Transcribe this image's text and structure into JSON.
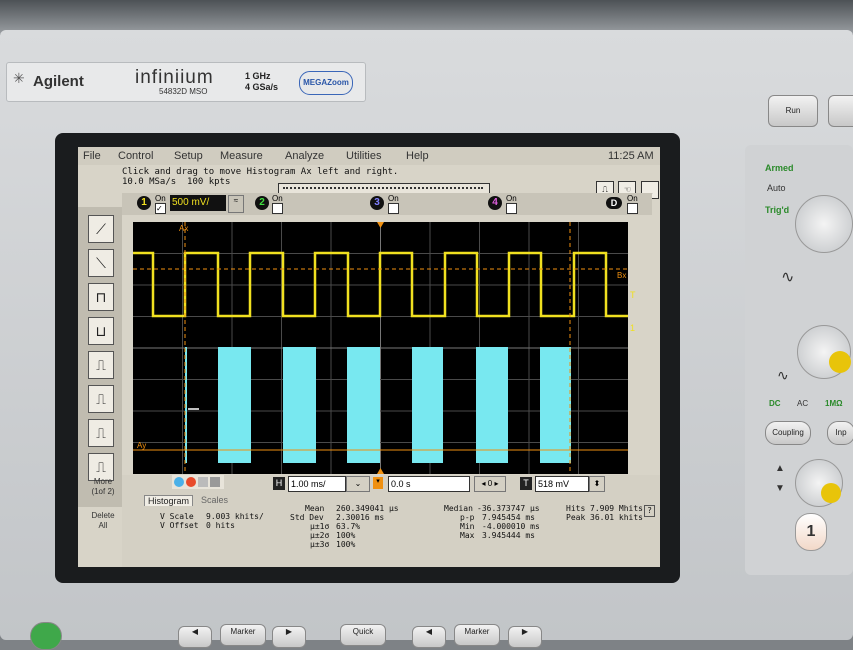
{
  "branding": {
    "logo": "Agilent",
    "model": "infiniium",
    "model_number": "54832D MSO",
    "bandwidth": "1 GHz",
    "sample_rate": "4 GSa/s",
    "megazoom": "MEGAZoom"
  },
  "menu": [
    "File",
    "Control",
    "Setup",
    "Measure",
    "Analyze",
    "Utilities",
    "Help"
  ],
  "clock": "11:25 AM",
  "hint": "Click and drag to move Histogram Ax left and right.",
  "acq": {
    "rate": "10.0 MSa/s",
    "points": "100 kpts"
  },
  "channels": [
    {
      "num": "1",
      "on": "On",
      "scale": "500 mV/"
    },
    {
      "num": "2",
      "on": "On"
    },
    {
      "num": "3",
      "on": "On"
    },
    {
      "num": "4",
      "on": "On"
    },
    {
      "num": "D",
      "on": "On"
    }
  ],
  "markers": {
    "ax": "Ax",
    "ay": "Ay",
    "bx": "Bx",
    "t": "T",
    "one": "1"
  },
  "sidebar": {
    "more": "More",
    "more_page": "(1of 2)",
    "delete": "Delete",
    "all": "All"
  },
  "horizontal": {
    "label": "H",
    "scale": "1.00 ms/",
    "delay": "0.0 s"
  },
  "trigger": {
    "label": "T",
    "level": "518 mV"
  },
  "tabs": {
    "histogram": "Histogram",
    "scales": "Scales"
  },
  "stats": {
    "vscale_label": "V Scale",
    "vscale": "9.003 khits/",
    "voffset_label": "V Offset",
    "voffset": "0 hits",
    "mean_label": "Mean",
    "mean": "260.349041 µs",
    "std_label": "Std Dev",
    "std": "2.30016 ms",
    "s1_label": "µ±1σ",
    "s1": "63.7%",
    "s2_label": "µ±2σ",
    "s2": "100%",
    "s3_label": "µ±3σ",
    "s3": "100%",
    "median_label": "Median",
    "median": "-36.373747 µs",
    "pp_label": "p-p",
    "pp": "7.945454 ms",
    "min_label": "Min",
    "min": "-4.000010 ms",
    "max_label": "Max",
    "max": "3.945444 ms",
    "hits_label": "Hits",
    "hits": "7.909 Mhits",
    "peak_label": "Peak",
    "peak": "36.01 khits"
  },
  "panel": {
    "armed": "Armed",
    "auto": "Auto",
    "trigd": "Trig'd",
    "run": "Run",
    "dc": "DC",
    "ac": "AC",
    "ohm": "1MΩ",
    "coupling": "Coupling",
    "input": "Inp",
    "ch_num": "1"
  },
  "front": {
    "marker1": "Marker",
    "quick": "Quick",
    "marker2": "Marker"
  },
  "colors": {
    "trace": "#f0e020",
    "histogram": "#78e8f0",
    "grid": "#5a5a5a",
    "marker": "#f09010"
  }
}
